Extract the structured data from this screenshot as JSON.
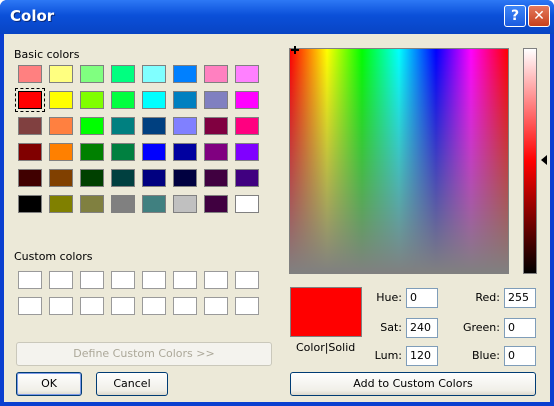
{
  "window": {
    "title": "Color",
    "help_glyph": "?",
    "close_glyph": "✕"
  },
  "basic_colors": {
    "label": "Basic colors",
    "rows": [
      [
        "#ff8080",
        "#ffff80",
        "#80ff80",
        "#00ff80",
        "#80ffff",
        "#0080ff",
        "#ff80c0",
        "#ff80ff"
      ],
      [
        "#ff0000",
        "#ffff00",
        "#80ff00",
        "#00ff40",
        "#00ffff",
        "#0080c0",
        "#8080c0",
        "#ff00ff"
      ],
      [
        "#804040",
        "#ff8040",
        "#00ff00",
        "#008080",
        "#004080",
        "#8080ff",
        "#800040",
        "#ff0080"
      ],
      [
        "#800000",
        "#ff8000",
        "#008000",
        "#008040",
        "#0000ff",
        "#0000a0",
        "#800080",
        "#8000ff"
      ],
      [
        "#400000",
        "#804000",
        "#004000",
        "#004040",
        "#000080",
        "#000040",
        "#400040",
        "#400080"
      ],
      [
        "#000000",
        "#808000",
        "#808040",
        "#808080",
        "#408080",
        "#c0c0c0",
        "#400040",
        "#ffffff"
      ]
    ],
    "selected_row": 1,
    "selected_col": 0
  },
  "custom_colors": {
    "label": "Custom colors",
    "rows": 2,
    "cols": 8
  },
  "buttons": {
    "define": "Define Custom Colors >>",
    "ok": "OK",
    "cancel": "Cancel",
    "add": "Add to Custom Colors"
  },
  "preview": {
    "label": "Color|Solid",
    "color": "#ff0000"
  },
  "fields": {
    "hue_label": "Hue:",
    "hue": "0",
    "sat_label": "Sat:",
    "sat": "240",
    "lum_label": "Lum:",
    "lum": "120",
    "red_label": "Red:",
    "red": "255",
    "green_label": "Green:",
    "green": "0",
    "blue_label": "Blue:",
    "blue": "0"
  }
}
